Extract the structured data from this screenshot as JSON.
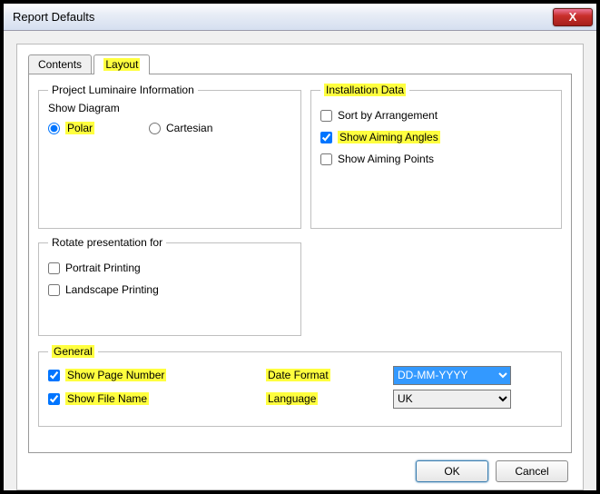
{
  "window": {
    "title": "Report Defaults",
    "close": "X"
  },
  "tabs": {
    "contents": "Contents",
    "layout": "Layout"
  },
  "luminaire": {
    "legend": "Project Luminaire Information",
    "show_diagram": "Show Diagram",
    "polar": "Polar",
    "cartesian": "Cartesian"
  },
  "install": {
    "legend": "Installation Data",
    "sort": "Sort by Arrangement",
    "angles": "Show Aiming Angles",
    "points": "Show Aiming Points"
  },
  "rotate": {
    "legend": "Rotate presentation for",
    "portrait": "Portrait Printing",
    "landscape": "Landscape Printing"
  },
  "general": {
    "legend": "General",
    "page_number": "Show Page Number",
    "file_name": "Show File Name",
    "date_format_label": "Date Format",
    "language_label": "Language",
    "date_format_value": "DD-MM-YYYY",
    "language_value": "UK"
  },
  "buttons": {
    "ok": "OK",
    "cancel": "Cancel"
  }
}
